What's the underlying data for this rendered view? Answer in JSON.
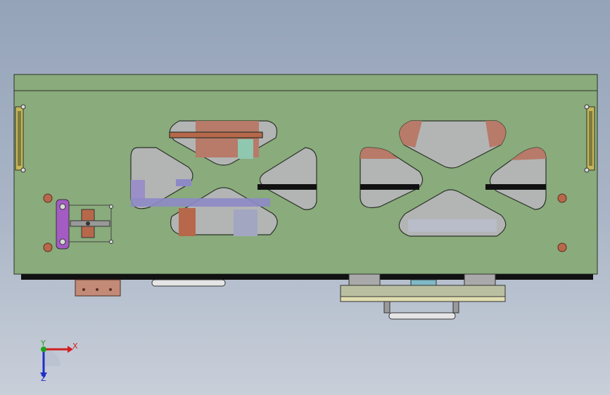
{
  "app": {
    "title": ""
  },
  "viewport": {
    "background_top": "#95a3b9",
    "background_bottom": "#c9cfd9"
  },
  "model": {
    "plate_color": "#8aab7c",
    "edge_color": "#2b3327",
    "cutout_fill": "#b2b5b4",
    "copper_color": "#b7684b",
    "purple_color": "#a45bc4",
    "blue_purple_color": "#8d89c7"
  },
  "triad": {
    "x_label": "X",
    "y_label": "Y",
    "z_label": "Z",
    "x_color": "#d21f1f",
    "y_color": "#1fa21f",
    "z_color": "#1f2fc8"
  }
}
